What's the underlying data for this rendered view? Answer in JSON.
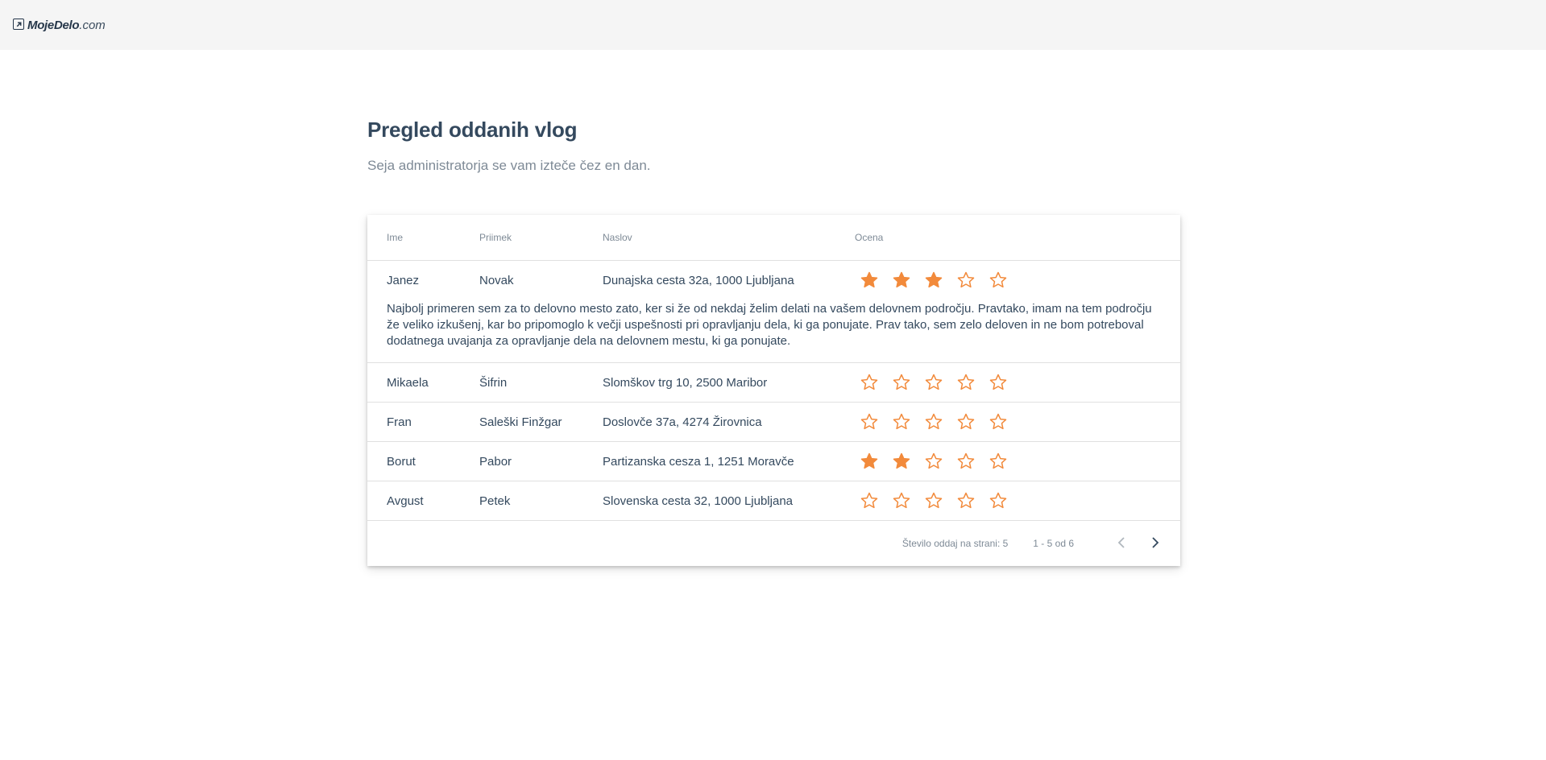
{
  "logo": {
    "bold": "MojeDelo",
    "light": ".com",
    "icon": "external-arrow-icon"
  },
  "page": {
    "title": "Pregled oddanih vlog",
    "subtitle": "Seja administratorja se vam izteče čez en dan."
  },
  "table": {
    "headers": {
      "ime": "Ime",
      "priimek": "Priimek",
      "naslov": "Naslov",
      "ocena": "Ocena"
    },
    "rating_max": 5,
    "rows": [
      {
        "ime": "Janez",
        "priimek": "Novak",
        "naslov": "Dunajska cesta 32a, 1000 Ljubljana",
        "rating": 3,
        "motivation": "Najbolj primeren sem za to delovno mesto zato, ker si že od nekdaj želim delati na vašem delovnem področju. Pravtako, imam na tem področju že veliko izkušenj, kar bo pripomoglo k večji uspešnosti pri opravljanju dela, ki ga ponujate. Prav tako, sem zelo deloven in ne bom potreboval dodatnega uvajanja za opravljanje dela na delovnem mestu, ki ga ponujate."
      },
      {
        "ime": "Mikaela",
        "priimek": "Šifrin",
        "naslov": "Slomškov trg 10, 2500 Maribor",
        "rating": 0
      },
      {
        "ime": "Fran",
        "priimek": "Saleški Finžgar",
        "naslov": "Doslovče 37a, 4274 Žirovnica",
        "rating": 0
      },
      {
        "ime": "Borut",
        "priimek": "Pabor",
        "naslov": "Partizanska cesza 1, 1251 Moravče",
        "rating": 2
      },
      {
        "ime": "Avgust",
        "priimek": "Petek",
        "naslov": "Slovenska cesta 32, 1000 Ljubljana",
        "rating": 0
      }
    ]
  },
  "paginator": {
    "page_size_label": "Število oddaj na strani: 5",
    "range_label": "1 - 5 od 6",
    "prev_icon": "chevron-left-icon",
    "next_icon": "chevron-right-icon"
  },
  "colors": {
    "accent_star": "#f28a3b",
    "text_dark": "#34495e",
    "text_muted": "#7e8a96",
    "topbar_bg": "#f5f5f5"
  }
}
